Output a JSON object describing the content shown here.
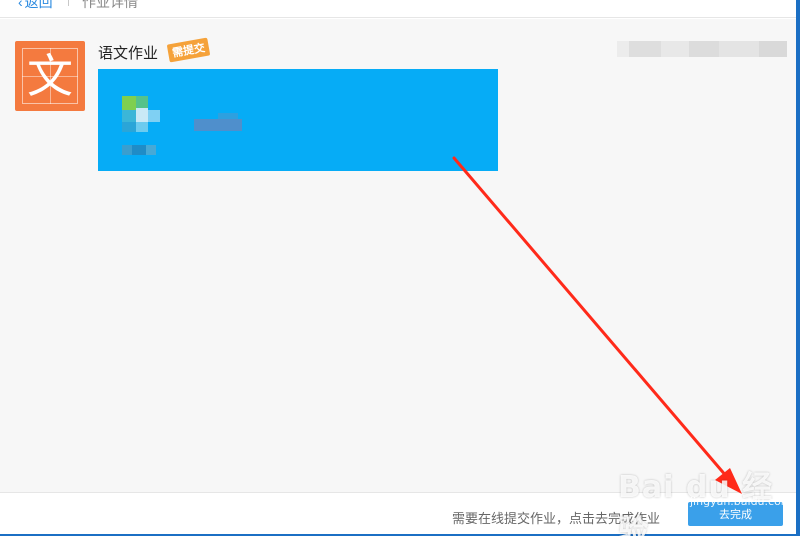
{
  "topbar": {
    "back_label": "返回",
    "breadcrumb": "作业详情"
  },
  "homework": {
    "avatar_char": "文",
    "title": "语文作业",
    "badge": "需提交"
  },
  "footer": {
    "hint": "需要在线提交作业，点击去完成作业",
    "button_label": "去完成"
  },
  "watermark": {
    "text": "Bai du 经验",
    "sub": "jingyan.baidu.com"
  },
  "colors": {
    "avatar_bg": "#f47a3f",
    "badge_bg": "#f5a23a",
    "card_bg": "#06acf6",
    "button_bg": "#3aa0ea",
    "arrow": "#ff2a1a"
  }
}
